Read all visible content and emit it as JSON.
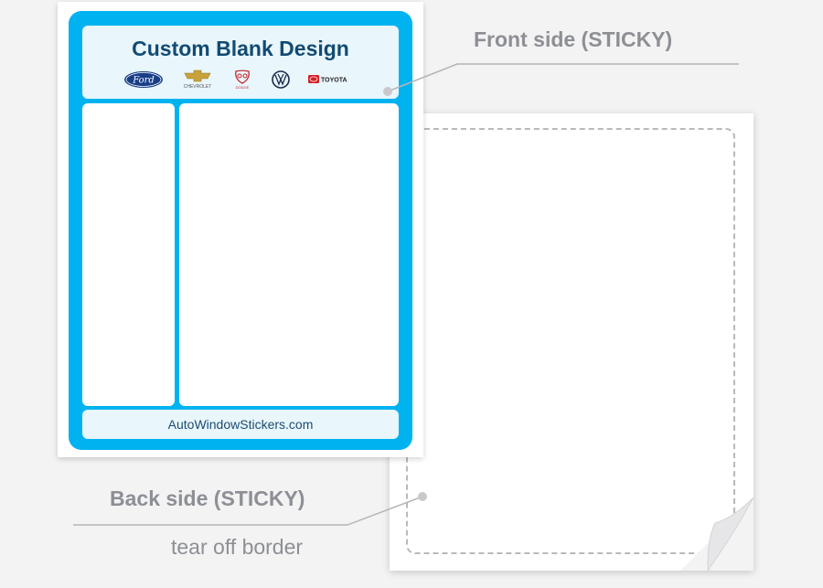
{
  "front_sheet": {
    "title": "Custom Blank Design",
    "brands": [
      {
        "name": "Ford",
        "icon": "ford-logo-icon"
      },
      {
        "name": "CHEVROLET",
        "icon": "chevrolet-logo-icon"
      },
      {
        "name": "DODGE",
        "icon": "dodge-ram-logo-icon"
      },
      {
        "name": "VW",
        "icon": "volkswagen-logo-icon"
      },
      {
        "name": "TOYOTA",
        "icon": "toyota-logo-icon"
      }
    ],
    "footer_url": "AutoWindowStickers.com"
  },
  "labels": {
    "front": "Front side (STICKY)",
    "back": "Back side  (STICKY)",
    "tear": "tear off border"
  },
  "colors": {
    "frame": "#00b3f0",
    "title": "#124b73",
    "label": "#8d8f95",
    "background": "#f3f3f4"
  }
}
